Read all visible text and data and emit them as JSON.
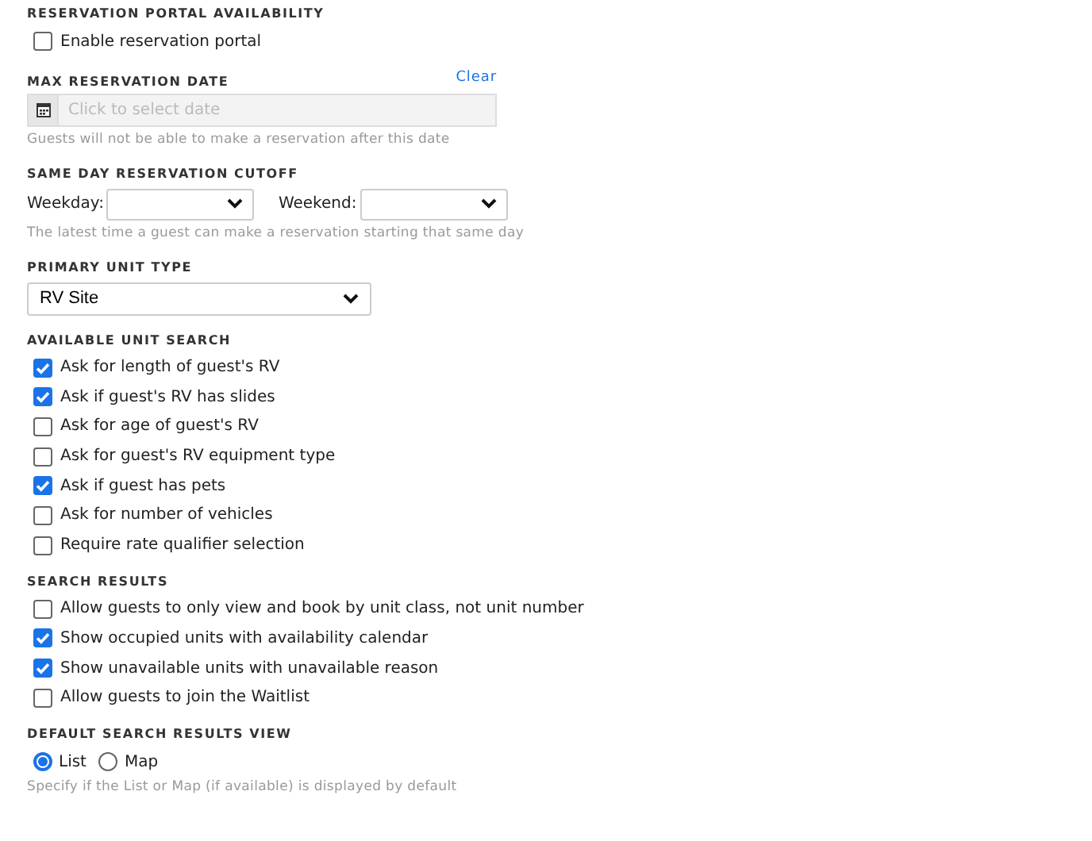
{
  "sections": [
    {
      "kind": "checkboxes",
      "heading": "RESERVATION PORTAL AVAILABILITY",
      "options": [
        {
          "label": "Enable reservation portal",
          "checked": false
        }
      ]
    },
    {
      "kind": "date",
      "heading": "MAX RESERVATION DATE",
      "clear": "Clear",
      "placeholder": "Click to select date",
      "hint": "Guests will not be able to make a reservation after this date"
    },
    {
      "kind": "cutoff",
      "heading": "SAME DAY RESERVATION CUTOFF",
      "fields": [
        {
          "label": "Weekday:"
        },
        {
          "label": "Weekend:"
        }
      ],
      "hint": "The latest time a guest can make a reservation starting that same day"
    },
    {
      "kind": "select",
      "heading": "PRIMARY UNIT TYPE",
      "value": "RV Site"
    },
    {
      "kind": "checkboxes",
      "heading": "AVAILABLE UNIT SEARCH",
      "options": [
        {
          "label": "Ask for length of guest's RV",
          "checked": true
        },
        {
          "label": "Ask if guest's RV has slides",
          "checked": true
        },
        {
          "label": "Ask for age of guest's RV",
          "checked": false
        },
        {
          "label": "Ask for guest's RV equipment type",
          "checked": false
        },
        {
          "label": "Ask if guest has pets",
          "checked": true
        },
        {
          "label": "Ask for number of vehicles",
          "checked": false
        },
        {
          "label": "Require rate qualifier selection",
          "checked": false
        }
      ]
    },
    {
      "kind": "checkboxes",
      "heading": "SEARCH RESULTS",
      "options": [
        {
          "label": "Allow guests to only view and book by unit class, not unit number",
          "checked": false
        },
        {
          "label": "Show occupied units with availability calendar",
          "checked": true
        },
        {
          "label": "Show unavailable units with unavailable reason",
          "checked": true
        },
        {
          "label": "Allow guests to join the Waitlist",
          "checked": false
        }
      ]
    },
    {
      "kind": "radios",
      "heading": "DEFAULT SEARCH RESULTS VIEW",
      "options": [
        {
          "label": "List",
          "selected": true
        },
        {
          "label": "Map",
          "selected": false
        }
      ],
      "hint": "Specify if the List or Map (if available) is displayed by default"
    }
  ]
}
